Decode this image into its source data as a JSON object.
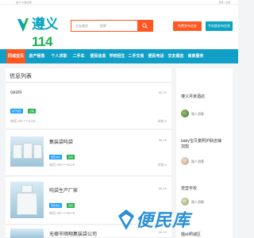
{
  "topbar": {
    "left_text": "遵义114信息网",
    "right_text": "登录 | 注册"
  },
  "header": {
    "logo_text": "遵义",
    "logo_num": "114",
    "search": {
      "category": "交友婚恋",
      "placeholder": "搜索"
    },
    "post_button": "免费发布信息",
    "mobile_button": "手机版发布信息"
  },
  "nav": {
    "items": [
      "同城首页",
      "房产租售",
      "个人求职",
      "二手车",
      "便民信息",
      "学校招生",
      "二手交易",
      "便民电话",
      "交友婚恋",
      "商家服务"
    ]
  },
  "main": {
    "list_title": "信息列表",
    "items": [
      {
        "title": "ceshi",
        "date": "05-21",
        "tags": [
          "房产租售",
          "出租"
        ],
        "phone": "电话:152 ****4752",
        "side": "遵义",
        "views": "浏览:0"
      },
      {
        "title": "集装袋吨袋",
        "date": "06-19",
        "tags": [
          "便民信息",
          "其他"
        ],
        "phone": "电话:189 ****5278",
        "side": "浏览:0"
      },
      {
        "title": "吨袋生产厂家",
        "date": "06-19",
        "tags": [
          "便民信息",
          "其他"
        ],
        "phone": "电话:189 ****5278",
        "side": "浏览:0"
      },
      {
        "title": "无棣市顺翔集装袋公司",
        "date": "06-19"
      }
    ]
  },
  "sidebar": {
    "entries": [
      {
        "title": "遵义月家酒店"
      },
      {
        "title": "baby宝贝童照护肤店铺",
        "sub": "加盟"
      },
      {
        "title": "党营学校"
      },
      {
        "title": "婚纱照城区"
      }
    ],
    "users": [
      "路人游客",
      "路人游客",
      "路人游客",
      "路人游客"
    ]
  },
  "watermark": {
    "text": "便民库"
  },
  "colors": {
    "accent": "#ff5722",
    "nav": "#0f9fc7",
    "brand": "#0aa3c2",
    "tag_blue": "#1e9fff",
    "tag_green": "#23b14d"
  }
}
